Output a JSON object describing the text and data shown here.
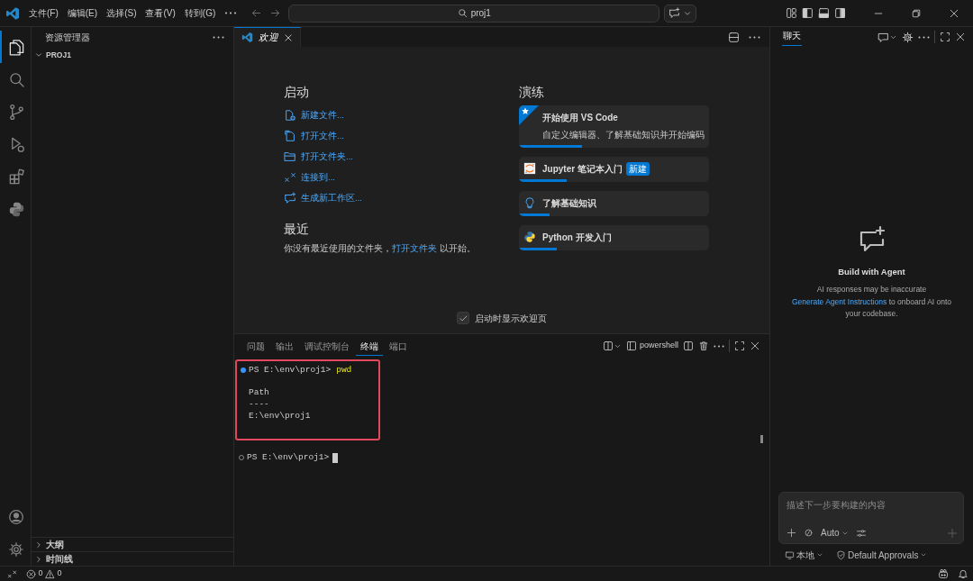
{
  "title_bar": {
    "menus": [
      "文件(F)",
      "编辑(E)",
      "选择(S)",
      "查看(V)",
      "转到(G)"
    ],
    "command_center": {
      "label": "proj1"
    }
  },
  "activity_bar": {
    "items": [
      {
        "selected": true
      },
      {
        "selected": false
      },
      {
        "selected": false
      },
      {
        "selected": false
      },
      {
        "selected": false
      },
      {
        "selected": false
      }
    ]
  },
  "sidebar": {
    "title": "资源管理器",
    "folder": {
      "label": "PROJ1",
      "expanded": true
    },
    "sections": [
      {
        "label": "大纲",
        "expanded": false
      },
      {
        "label": "时间线",
        "expanded": false
      }
    ]
  },
  "editor": {
    "tabs": [
      {
        "label": "欢迎",
        "selected": true
      }
    ],
    "welcome": {
      "start": {
        "heading": "启动",
        "actions": [
          "新建文件...",
          "打开文件...",
          "打开文件夹...",
          "连接到...",
          "生成新工作区..."
        ]
      },
      "recent": {
        "heading": "最近",
        "text_before": "你没有最近使用的文件夹，",
        "link": "打开文件夹",
        "text_after": " 以开始。"
      },
      "walkthroughs": {
        "heading": "演练",
        "items": [
          {
            "title": "开始使用 VS Code",
            "description": "自定义编辑器、了解基础知识并开始编码",
            "featured": true,
            "level": 0.33
          },
          {
            "title": "Jupyter 笔记本入门",
            "badge": "新建",
            "featured": false,
            "level": 0.25
          },
          {
            "title": "了解基础知识",
            "featured": false,
            "level": 0.16
          },
          {
            "title": "Python 开发入门",
            "featured": false,
            "level": 0.2
          }
        ]
      },
      "show_on_startup": {
        "label": "启动时显示欢迎页",
        "checked": true
      }
    }
  },
  "panel": {
    "tabs": [
      {
        "label": "问题",
        "selected": false
      },
      {
        "label": "输出",
        "selected": false
      },
      {
        "label": "调试控制台",
        "selected": false
      },
      {
        "label": "终端",
        "selected": true
      },
      {
        "label": "端口",
        "selected": false
      }
    ],
    "shell": "powershell",
    "terminal": [
      {
        "kind": "prompt",
        "prompt": "PS E:\\env\\proj1>",
        "command": "pwd",
        "completed": true,
        "highlighted": true
      },
      {
        "kind": "blank",
        "highlighted": true
      },
      {
        "kind": "output",
        "text": "Path",
        "highlighted": true
      },
      {
        "kind": "output",
        "text": "----",
        "highlighted": true
      },
      {
        "kind": "output",
        "text": "E:\\env\\proj1",
        "highlighted": true
      },
      {
        "kind": "blank",
        "highlighted": true
      },
      {
        "kind": "blank",
        "highlighted": false
      },
      {
        "kind": "prompt",
        "prompt": "PS E:\\env\\proj1>",
        "completed": false,
        "cursor": true,
        "highlighted": false
      }
    ]
  },
  "chat": {
    "tabs": [
      {
        "label": "聊天",
        "selected": true
      }
    ],
    "empty_state": {
      "title": "Build with Agent",
      "note": "AI responses may be inaccurate",
      "link": "Generate Agent Instructions",
      "text_after": " to onboard AI onto your codebase."
    },
    "input": {
      "placeholder": "描述下一步要构建的内容",
      "mode": "Auto"
    },
    "footer": {
      "location": "本地",
      "approvals": "Default Approvals"
    }
  },
  "status_bar": {
    "errors": "0",
    "warnings": "0"
  }
}
